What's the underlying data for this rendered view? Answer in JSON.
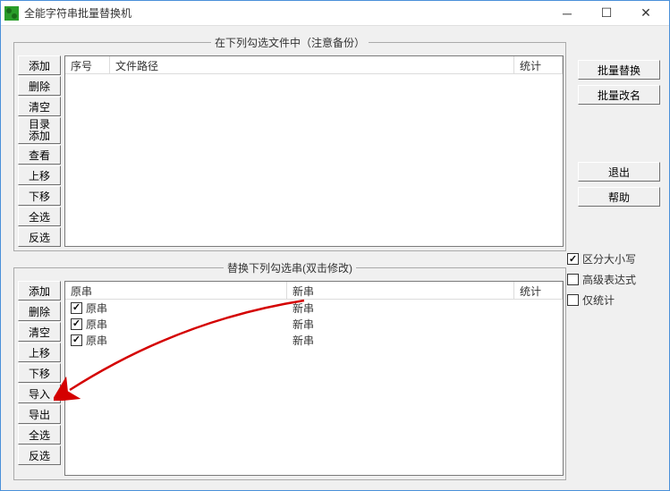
{
  "title": "全能字符串批量替换机",
  "panels": {
    "top": {
      "legend": "在下列勾选文件中（注意备份）",
      "columns": {
        "seq": "序号",
        "path": "文件路径",
        "stat": "统计"
      },
      "buttons": [
        "添加",
        "删除",
        "清空",
        "目录\n添加",
        "查看",
        "上移",
        "下移",
        "全选",
        "反选"
      ]
    },
    "bottom": {
      "legend": "替换下列勾选串(双击修改)",
      "columns": {
        "old": "原串",
        "new": "新串",
        "stat": "统计"
      },
      "buttons": [
        "添加",
        "删除",
        "清空",
        "上移",
        "下移",
        "导入",
        "导出",
        "全选",
        "反选"
      ],
      "rows": [
        {
          "checked": true,
          "old": "原串",
          "new": "新串"
        },
        {
          "checked": true,
          "old": "原串",
          "new": "新串"
        },
        {
          "checked": true,
          "old": "原串",
          "new": "新串"
        }
      ]
    }
  },
  "right": {
    "batchReplace": "批量替换",
    "batchRename": "批量改名",
    "exit": "退出",
    "help": "帮助"
  },
  "options": {
    "caseSensitive": {
      "label": "区分大小写",
      "checked": true
    },
    "advancedExpr": {
      "label": "高级表达式",
      "checked": false
    },
    "statOnly": {
      "label": "仅统计",
      "checked": false
    }
  }
}
